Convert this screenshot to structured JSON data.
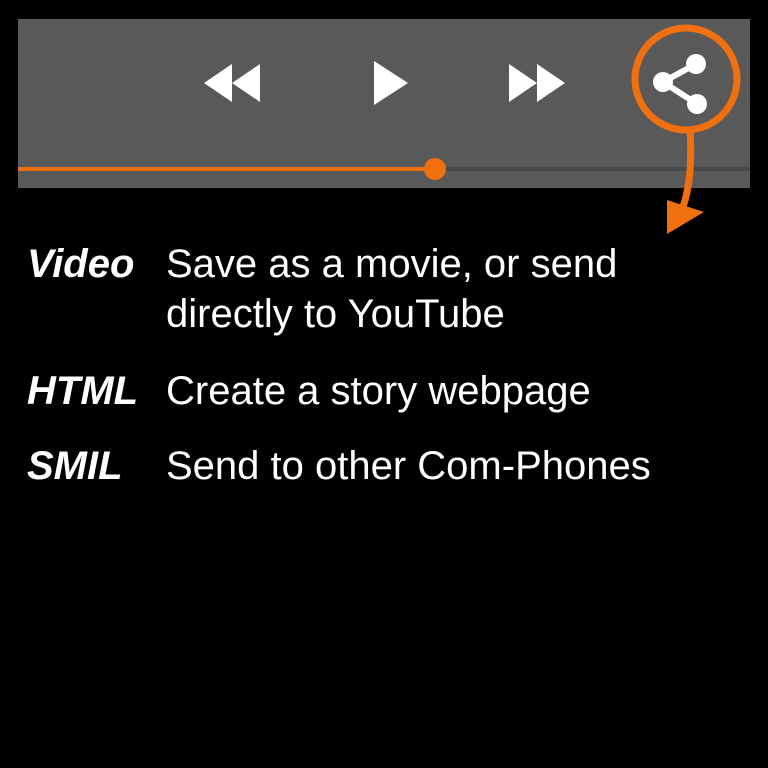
{
  "player": {
    "controls": {
      "rewind_icon": "rewind-icon",
      "play_icon": "play-icon",
      "fast_forward_icon": "fast-forward-icon",
      "share_icon": "share-icon"
    },
    "progress": 0.57,
    "colors": {
      "panel": "#595959",
      "accent": "#f07010",
      "icon": "#ffffff",
      "track": "#474747"
    }
  },
  "export_options": [
    {
      "term": "Video",
      "desc": [
        "Save as a movie, or send",
        "directly to YouTube"
      ]
    },
    {
      "term": "HTML",
      "desc": [
        "Create a story webpage"
      ]
    },
    {
      "term": "SMIL",
      "desc": [
        "Send to other Com-Phones"
      ]
    }
  ]
}
